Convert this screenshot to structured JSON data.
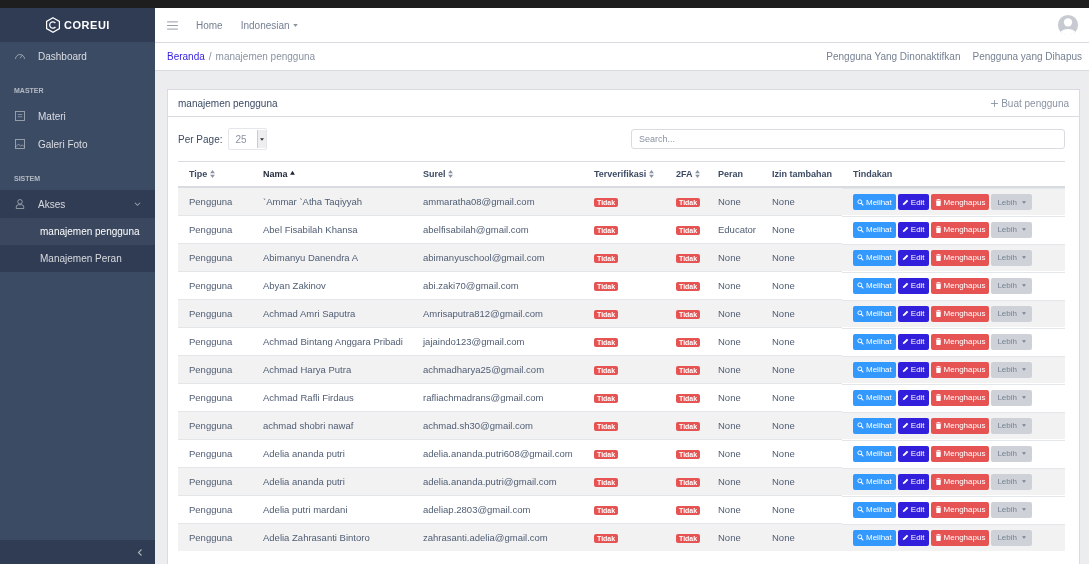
{
  "sidebar": {
    "brand": "COREUI",
    "items": [
      {
        "kind": "item",
        "label": "Dashboard",
        "selected": false
      },
      {
        "kind": "heading",
        "label": "MASTER"
      },
      {
        "kind": "item",
        "label": "Materi",
        "selected": false
      },
      {
        "kind": "item",
        "label": "Galeri Foto",
        "selected": false
      },
      {
        "kind": "heading",
        "label": "SISTEM"
      },
      {
        "kind": "group",
        "label": "Akses",
        "expanded": true,
        "children": [
          {
            "label": "manajemen pengguna",
            "selected": true
          },
          {
            "label": "Manajemen Peran",
            "selected": false
          }
        ]
      }
    ]
  },
  "header": {
    "nav": [
      {
        "label": "Home",
        "dropdown": false
      },
      {
        "label": "Indonesian",
        "dropdown": true
      }
    ]
  },
  "breadcrumb": {
    "separator": "/",
    "items": [
      {
        "label": "Beranda",
        "link": true
      },
      {
        "label": "manajemen pengguna",
        "link": false
      }
    ],
    "links": [
      "Pengguna Yang Dinonaktifkan",
      "Pengguna yang Dihapus"
    ]
  },
  "card": {
    "title": "manajemen pengguna",
    "create": "Buat pengguna",
    "per_page_label": "Per Page:",
    "per_page": "25",
    "search": {
      "placeholder": "Search..."
    },
    "columns": [
      {
        "label": "Tipe",
        "sortable": true,
        "sorted": false
      },
      {
        "label": "Nama",
        "sortable": true,
        "sorted": true
      },
      {
        "label": "Surel",
        "sortable": true,
        "sorted": false
      },
      {
        "label": "Terverifikasi",
        "sortable": true,
        "sorted": false
      },
      {
        "label": "2FA",
        "sortable": true,
        "sorted": false
      },
      {
        "label": "Peran",
        "sortable": false
      },
      {
        "label": "Izin tambahan",
        "sortable": false
      },
      {
        "label": "Tindakan",
        "sortable": false
      }
    ],
    "rows": [
      {
        "tipe": "Pengguna",
        "nama": "`Ammar `Atha Taqiyyah",
        "surel": "ammaratha08@gmail.com",
        "verified": "Tidak",
        "twofa": "Tidak",
        "peran": "None",
        "izin": "None",
        "actions": [
          "Melihat",
          "Edit",
          "Menghapus",
          "Lebih"
        ]
      },
      {
        "tipe": "Pengguna",
        "nama": "Abel Fisabilah Khansa",
        "surel": "abelfisabilah@gmail.com",
        "verified": "Tidak",
        "twofa": "Tidak",
        "peran": "Educator",
        "izin": "None",
        "actions": [
          "Melihat",
          "Edit",
          "Menghapus",
          "Lebih"
        ]
      },
      {
        "tipe": "Pengguna",
        "nama": "Abimanyu Danendra A",
        "surel": "abimanyuschool@gmail.com",
        "verified": "Tidak",
        "twofa": "Tidak",
        "peran": "None",
        "izin": "None",
        "actions": [
          "Melihat",
          "Edit",
          "Menghapus",
          "Lebih"
        ]
      },
      {
        "tipe": "Pengguna",
        "nama": "Abyan Zakinov",
        "surel": "abi.zaki70@gmail.com",
        "verified": "Tidak",
        "twofa": "Tidak",
        "peran": "None",
        "izin": "None",
        "actions": [
          "Melihat",
          "Edit",
          "Menghapus",
          "Lebih"
        ]
      },
      {
        "tipe": "Pengguna",
        "nama": "Achmad Amri Saputra",
        "surel": "Amrisaputra812@gmail.com",
        "verified": "Tidak",
        "twofa": "Tidak",
        "peran": "None",
        "izin": "None",
        "actions": [
          "Melihat",
          "Edit",
          "Menghapus",
          "Lebih"
        ]
      },
      {
        "tipe": "Pengguna",
        "nama": "Achmad Bintang Anggara Pribadi",
        "surel": "jajaindo123@gmail.com",
        "verified": "Tidak",
        "twofa": "Tidak",
        "peran": "None",
        "izin": "None",
        "actions": [
          "Melihat",
          "Edit",
          "Menghapus",
          "Lebih"
        ]
      },
      {
        "tipe": "Pengguna",
        "nama": "Achmad Harya Putra",
        "surel": "achmadharya25@gmail.com",
        "verified": "Tidak",
        "twofa": "Tidak",
        "peran": "None",
        "izin": "None",
        "actions": [
          "Melihat",
          "Edit",
          "Menghapus",
          "Lebih"
        ]
      },
      {
        "tipe": "Pengguna",
        "nama": "Achmad Rafli Firdaus",
        "surel": "rafliachmadrans@gmail.com",
        "verified": "Tidak",
        "twofa": "Tidak",
        "peran": "None",
        "izin": "None",
        "actions": [
          "Melihat",
          "Edit",
          "Menghapus",
          "Lebih"
        ]
      },
      {
        "tipe": "Pengguna",
        "nama": "achmad shobri nawaf",
        "surel": "achmad.sh30@gmail.com",
        "verified": "Tidak",
        "twofa": "Tidak",
        "peran": "None",
        "izin": "None",
        "actions": [
          "Melihat",
          "Edit",
          "Menghapus",
          "Lebih"
        ]
      },
      {
        "tipe": "Pengguna",
        "nama": "Adelia ananda putri",
        "surel": "adelia.ananda.putri608@gmail.com",
        "verified": "Tidak",
        "twofa": "Tidak",
        "peran": "None",
        "izin": "None",
        "actions": [
          "Melihat",
          "Edit",
          "Menghapus",
          "Lebih"
        ]
      },
      {
        "tipe": "Pengguna",
        "nama": "Adelia ananda putri",
        "surel": "adelia.ananda.putri@gmail.com",
        "verified": "Tidak",
        "twofa": "Tidak",
        "peran": "None",
        "izin": "None",
        "actions": [
          "Melihat",
          "Edit",
          "Menghapus",
          "Lebih"
        ]
      },
      {
        "tipe": "Pengguna",
        "nama": "Adelia putri mardani",
        "surel": "adeliap.2803@gmail.com",
        "verified": "Tidak",
        "twofa": "Tidak",
        "peran": "None",
        "izin": "None",
        "actions": [
          "Melihat",
          "Edit",
          "Menghapus",
          "Lebih"
        ]
      },
      {
        "tipe": "Pengguna",
        "nama": "Adelia Zahrasanti Bintoro",
        "surel": "zahrasanti.adelia@gmail.com",
        "verified": "Tidak",
        "twofa": "Tidak",
        "peran": "None",
        "izin": "None",
        "actions": [
          "Melihat",
          "Edit",
          "Menghapus",
          "Lebih"
        ]
      }
    ]
  }
}
